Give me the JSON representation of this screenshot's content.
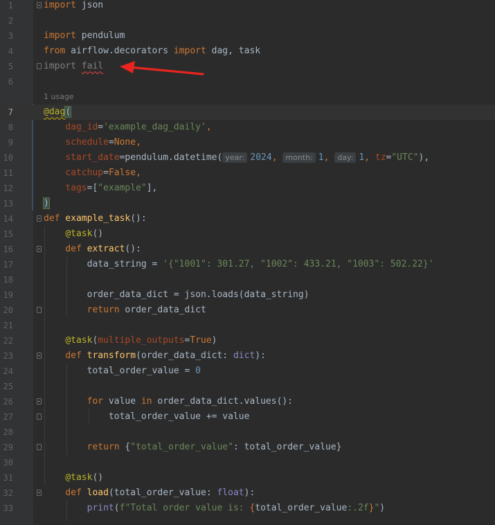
{
  "editor": {
    "usage_hint": "1 usage",
    "lines": [
      {
        "n": "1"
      },
      {
        "n": "2"
      },
      {
        "n": "3"
      },
      {
        "n": "4"
      },
      {
        "n": "5"
      },
      {
        "n": "6"
      },
      {
        "n": "7"
      },
      {
        "n": "8"
      },
      {
        "n": "9"
      },
      {
        "n": "10"
      },
      {
        "n": "11"
      },
      {
        "n": "12"
      },
      {
        "n": "13"
      },
      {
        "n": "14"
      },
      {
        "n": "15"
      },
      {
        "n": "16"
      },
      {
        "n": "17"
      },
      {
        "n": "18"
      },
      {
        "n": "19"
      },
      {
        "n": "20"
      },
      {
        "n": "21"
      },
      {
        "n": "22"
      },
      {
        "n": "23"
      },
      {
        "n": "24"
      },
      {
        "n": "25"
      },
      {
        "n": "26"
      },
      {
        "n": "27"
      },
      {
        "n": "28"
      },
      {
        "n": "29"
      },
      {
        "n": "30"
      },
      {
        "n": "31"
      },
      {
        "n": "32"
      },
      {
        "n": "33"
      }
    ],
    "tokens": {
      "l1_kw": "import",
      "l1_rest": " json",
      "l3_kw": "import",
      "l3_rest": " pendulum",
      "l4_kw1": "from",
      "l4_mid": " airflow.decorators ",
      "l4_kw2": "import",
      "l4_rest": " dag, task",
      "l5_kw": "import",
      "l5_sp": " ",
      "l5_mod": "fail",
      "l7_dec": "@dag",
      "l7_paren": "(",
      "l8_param": "dag_id",
      "l8_eq": "=",
      "l8_str": "'example_dag_daily'",
      "l8_comma": ",",
      "l9_param": "schedule",
      "l9_eq": "=",
      "l9_val": "None",
      "l9_comma": ",",
      "l10_param": "start_date",
      "l10_eq": "=",
      "l10_call": "pendulum.datetime(",
      "l10_hint1": "year:",
      "l10_num1": "2024",
      "l10_c1": ", ",
      "l10_hint2": "month:",
      "l10_num2": "1",
      "l10_c2": ", ",
      "l10_hint3": "day:",
      "l10_num3": "1",
      "l10_c3": ", ",
      "l10_param2": "tz",
      "l10_eq2": "=",
      "l10_str": "\"UTC\"",
      "l10_end": "),",
      "l11_param": "catchup",
      "l11_eq": "=",
      "l11_val": "False",
      "l11_comma": ",",
      "l12_param": "tags",
      "l12_eq": "=[",
      "l12_str": "\"example\"",
      "l12_end": "],",
      "l13_paren": ")",
      "l14_kw": "def",
      "l14_fn": " example_task",
      "l14_rest": "():",
      "l15_dec": "@task",
      "l15_rest": "()",
      "l16_kw": "def",
      "l16_fn": " extract",
      "l16_rest": "():",
      "l17_var": "data_string = ",
      "l17_str": "'{\"1001\": 301.27, \"1002\": 433.21, \"1003\": 502.22}'",
      "l19_code": "order_data_dict = json.loads(data_string)",
      "l20_kw": "return",
      "l20_rest": " order_data_dict",
      "l22_dec": "@task",
      "l22_p1": "(",
      "l22_param": "multiple_outputs",
      "l22_eq": "=",
      "l22_val": "True",
      "l22_p2": ")",
      "l23_kw": "def",
      "l23_fn": " transform",
      "l23_mid": "(order_data_dict: ",
      "l23_type": "dict",
      "l23_end": "):",
      "l24_var": "total_order_value = ",
      "l24_num": "0",
      "l26_kw1": "for",
      "l26_mid": " value ",
      "l26_kw2": "in",
      "l26_rest": " order_data_dict.values():",
      "l27_code": "total_order_value += value",
      "l29_kw": "return",
      "l29_p1": " {",
      "l29_str": "\"total_order_value\"",
      "l29_rest": ": total_order_value}",
      "l31_dec": "@task",
      "l31_rest": "()",
      "l32_kw": "def",
      "l32_fn": " load",
      "l32_mid": "(total_order_value: ",
      "l32_type": "float",
      "l32_end": "):",
      "l33_fn": "print",
      "l33_p1": "(",
      "l33_str1": "f\"Total order value is: ",
      "l33_b1": "{",
      "l33_expr": "total_order_value",
      "l33_fmt": ":.2f",
      "l33_b2": "}",
      "l33_str2": "\"",
      "l33_p2": ")"
    }
  },
  "annotation": {
    "arrow_color": "#e8251f"
  }
}
